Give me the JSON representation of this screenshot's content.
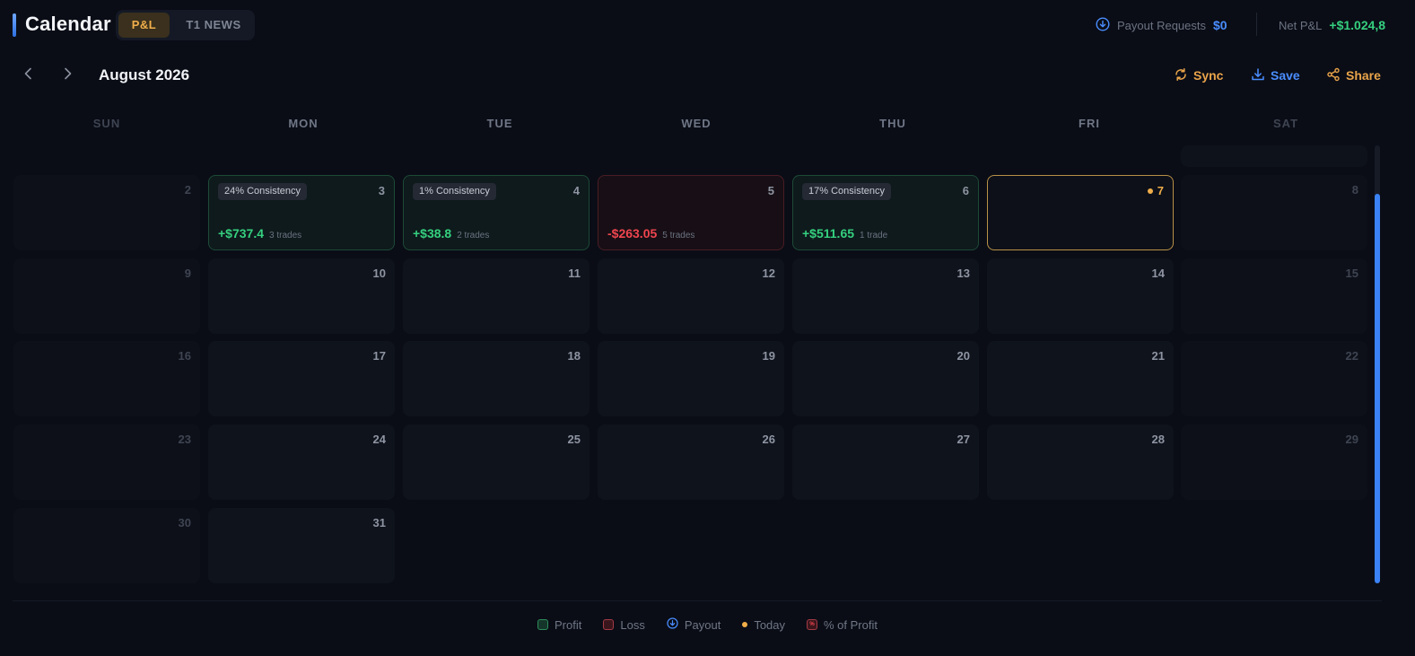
{
  "header": {
    "title": "Calendar",
    "tabs": [
      {
        "label": "P&L",
        "active": true
      },
      {
        "label": "T1 NEWS",
        "active": false
      }
    ],
    "payout_label": "Payout Requests",
    "payout_value": "$0",
    "net_pl_label": "Net P&L",
    "net_pl_value": "+$1.024,8"
  },
  "toolbar": {
    "month": "August 2026",
    "sync_label": "Sync",
    "save_label": "Save",
    "share_label": "Share"
  },
  "weekdays": [
    "SUN",
    "MON",
    "TUE",
    "WED",
    "THU",
    "FRI",
    "SAT"
  ],
  "days": {
    "d2": "2",
    "d3": "3",
    "d4": "4",
    "d5": "5",
    "d6": "6",
    "d7": "7",
    "d8": "8",
    "d9": "9",
    "d10": "10",
    "d11": "11",
    "d12": "12",
    "d13": "13",
    "d14": "14",
    "d15": "15",
    "d16": "16",
    "d17": "17",
    "d18": "18",
    "d19": "19",
    "d20": "20",
    "d21": "21",
    "d22": "22",
    "d23": "23",
    "d24": "24",
    "d25": "25",
    "d26": "26",
    "d27": "27",
    "d28": "28",
    "d29": "29",
    "d30": "30",
    "d31": "31"
  },
  "entries": {
    "d3": {
      "consistency": "24% Consistency",
      "pnl": "+$737.4",
      "trades": "3 trades"
    },
    "d4": {
      "consistency": "1% Consistency",
      "pnl": "+$38.8",
      "trades": "2 trades"
    },
    "d5": {
      "pnl": "-$263.05",
      "trades": "5 trades"
    },
    "d6": {
      "consistency": "17% Consistency",
      "pnl": "+$511.65",
      "trades": "1 trade"
    }
  },
  "legend": {
    "profit": "Profit",
    "loss": "Loss",
    "payout": "Payout",
    "today": "Today",
    "pct": "% of Profit",
    "pct_glyph": "%"
  },
  "colors": {
    "accent_blue": "#3b82f6",
    "accent_orange": "#f0ae4a",
    "profit_green": "#35d07f",
    "loss_red": "#f0454f",
    "background": "#0a0d16"
  },
  "icons": {
    "prev": "chevron-left-icon",
    "next": "chevron-right-icon",
    "sync": "sync-icon",
    "save": "download-icon",
    "share": "share-icon",
    "payout": "arrow-down-circle-icon"
  }
}
